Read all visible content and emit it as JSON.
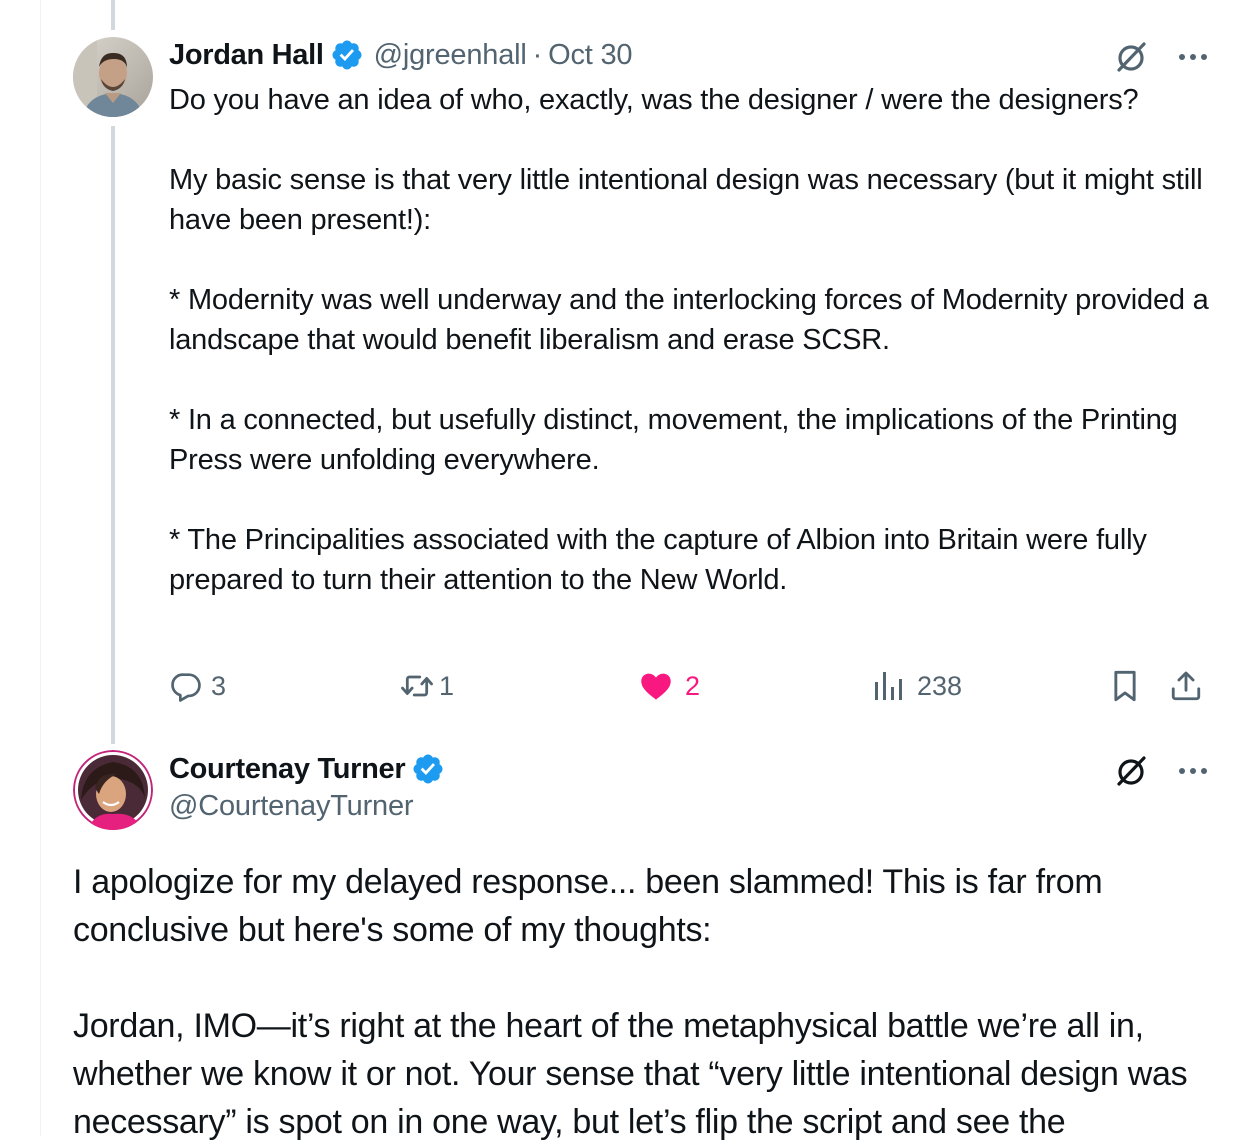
{
  "reply_tweet": {
    "author_name": "Jordan Hall",
    "handle": "@jgreenhall",
    "separator": "·",
    "date": "Oct 30",
    "paragraphs": [
      "Do you have an idea of who, exactly, was the designer / were the designers?",
      "My basic sense is that very little intentional design was necessary (but it might still have been present!):",
      "* Modernity was well underway and the interlocking forces of Modernity provided a landscape that would benefit liberalism and erase SCSR.",
      "* In a connected, but usefully distinct, movement, the implications of the Printing Press were unfolding everywhere.",
      "* The Principalities associated with the capture of Albion into Britain were fully prepared to turn their attention to the New World."
    ],
    "actions": {
      "replies": "3",
      "reposts": "1",
      "likes": "2",
      "views": "238"
    },
    "icons": {
      "verified": "verified-badge-icon",
      "grok": "grok-icon",
      "more": "more-icon",
      "reply": "reply-icon",
      "repost": "repost-icon",
      "like": "heart-icon",
      "views": "views-icon",
      "bookmark": "bookmark-icon",
      "share": "share-icon"
    }
  },
  "main_tweet": {
    "author_name": "Courtenay Turner",
    "handle": "@CourtenayTurner",
    "paragraphs": [
      "I apologize for my delayed response... been slammed! This is far from conclusive but here's some of my thoughts:",
      "Jordan, IMO—it’s right at the heart of the metaphysical battle we’re all in, whether we know it or not. Your sense that “very little intentional design was necessary” is spot on in one way, but let’s flip the script and see the"
    ]
  },
  "colors": {
    "text": "#0f1419",
    "secondary": "#536471",
    "verified": "#1d9bf0",
    "like": "#f91880",
    "thread_line": "#cfd9de"
  }
}
